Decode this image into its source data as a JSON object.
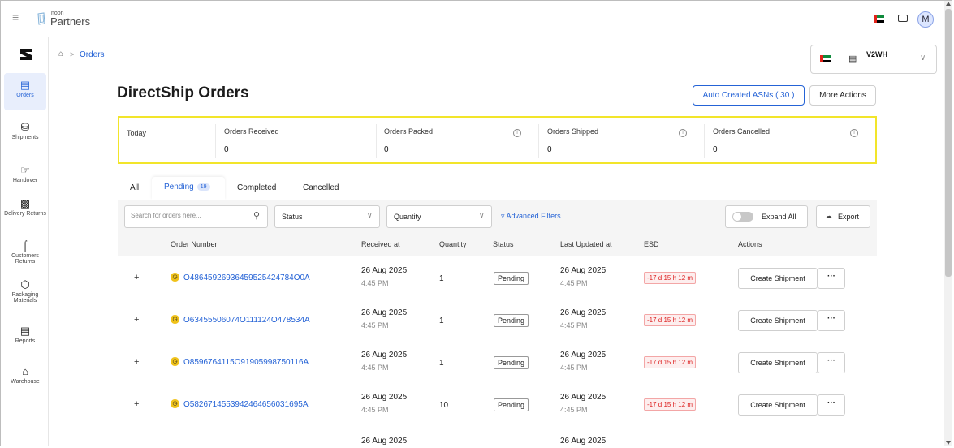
{
  "topbar": {
    "brand_small": "noon",
    "brand": "Partners",
    "menu_icon": "hamburger-icon",
    "mail_icon": "mail-icon",
    "avatar": "M"
  },
  "sidebar": {
    "items": [
      {
        "label": "Orders",
        "icon": "orders-icon"
      },
      {
        "label": "Shipments",
        "icon": "truck-icon"
      },
      {
        "label": "Handover",
        "icon": "handover-icon"
      },
      {
        "label": "Delivery Returns",
        "icon": "delivery-returns-icon"
      },
      {
        "label": "Customers Returns",
        "icon": "customer-returns-icon"
      },
      {
        "label": "Packaging Materials",
        "icon": "packaging-icon"
      },
      {
        "label": "Reports",
        "icon": "reports-icon"
      },
      {
        "label": "Warehouse",
        "icon": "warehouse-icon"
      }
    ]
  },
  "breadcrumb": {
    "current": "Orders"
  },
  "warehouse_selector": {
    "code": "V2WH"
  },
  "header": {
    "title": "DirectShip Orders",
    "asn_button": "Auto Created ASNs ( 30 )",
    "more_actions": "More Actions"
  },
  "stats": {
    "period": "Today",
    "items": [
      {
        "label": "Orders Received",
        "value": "0"
      },
      {
        "label": "Orders Packed",
        "value": "0"
      },
      {
        "label": "Orders Shipped",
        "value": "0"
      },
      {
        "label": "Orders Cancelled",
        "value": "0"
      }
    ]
  },
  "tabs": [
    {
      "label": "All"
    },
    {
      "label": "Pending",
      "badge": "19"
    },
    {
      "label": "Completed"
    },
    {
      "label": "Cancelled"
    }
  ],
  "toolbar": {
    "search_placeholder": "Search for orders here...",
    "status_dropdown": "Status",
    "quantity_dropdown": "Quantity",
    "advanced_filters": "Advanced Filters",
    "expand_all": "Expand All",
    "export": "Export"
  },
  "table": {
    "headers": [
      "Order Number",
      "Received at",
      "Quantity",
      "Status",
      "Last Updated at",
      "ESD",
      "Actions"
    ],
    "rows": [
      {
        "order": "O48645926936459525424784O0A",
        "received_date": "26 Aug 2025",
        "received_time": "4:45 PM",
        "qty": "1",
        "status": "Pending",
        "updated_date": "26 Aug 2025",
        "updated_time": "4:45 PM",
        "esd": "-17 d 15 h 12 m",
        "action": "Create Shipment"
      },
      {
        "order": "O63455506074O111124O478534A",
        "received_date": "26 Aug 2025",
        "received_time": "4:45 PM",
        "qty": "1",
        "status": "Pending",
        "updated_date": "26 Aug 2025",
        "updated_time": "4:45 PM",
        "esd": "-17 d 15 h 12 m",
        "action": "Create Shipment"
      },
      {
        "order": "O8596764115O91905998750116A",
        "received_date": "26 Aug 2025",
        "received_time": "4:45 PM",
        "qty": "1",
        "status": "Pending",
        "updated_date": "26 Aug 2025",
        "updated_time": "4:45 PM",
        "esd": "-17 d 15 h 12 m",
        "action": "Create Shipment"
      },
      {
        "order": "O5826714553942464656031695A",
        "received_date": "26 Aug 2025",
        "received_time": "4:45 PM",
        "qty": "10",
        "status": "Pending",
        "updated_date": "26 Aug 2025",
        "updated_time": "4:45 PM",
        "esd": "-17 d 15 h 12 m",
        "action": "Create Shipment"
      },
      {
        "order": "",
        "received_date": "26 Aug 2025",
        "received_time": "",
        "qty": "",
        "status": "",
        "updated_date": "26 Aug 2025",
        "updated_time": "",
        "esd": "",
        "action": ""
      }
    ]
  },
  "colors": {
    "accent": "#2563d6",
    "highlight_border": "#f2e52a",
    "esd_red": "#dd2222",
    "pending_clock": "#f0c21a"
  }
}
